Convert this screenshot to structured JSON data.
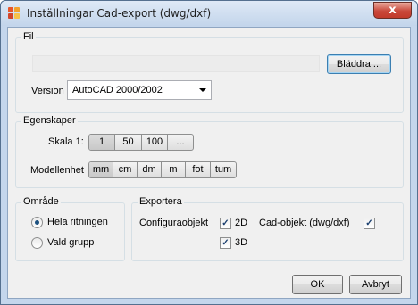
{
  "window": {
    "title": "Inställningar Cad-export (dwg/dxf)",
    "close_glyph": "x"
  },
  "file_group": {
    "title": "Fil",
    "path_value": "",
    "browse_label": "Bläddra ...",
    "version_label": "Version",
    "version_value": "AutoCAD 2000/2002"
  },
  "properties_group": {
    "title": "Egenskaper",
    "scale_label": "Skala 1:",
    "scale_options": [
      "1",
      "50",
      "100",
      "..."
    ],
    "scale_selected": "1",
    "unit_label": "Modellenhet",
    "unit_options": [
      "mm",
      "cm",
      "dm",
      "m",
      "fot",
      "tum"
    ],
    "unit_selected": "mm"
  },
  "area_group": {
    "title": "Område",
    "options": [
      {
        "label": "Hela ritningen",
        "selected": true
      },
      {
        "label": "Vald grupp",
        "selected": false
      }
    ]
  },
  "export_group": {
    "title": "Exportera",
    "config_label": "Configuraobjekt",
    "check_2d_label": "2D",
    "check_2d": true,
    "check_3d_label": "3D",
    "check_3d": true,
    "cad_label": "Cad-objekt (dwg/dxf)",
    "cad_checked": true,
    "check_glyph": "✓"
  },
  "buttons": {
    "ok": "OK",
    "cancel": "Avbryt"
  },
  "colors": {
    "icon": [
      "#e8572a",
      "#f2a22c",
      "#d2452a",
      "#f7c34b"
    ]
  }
}
